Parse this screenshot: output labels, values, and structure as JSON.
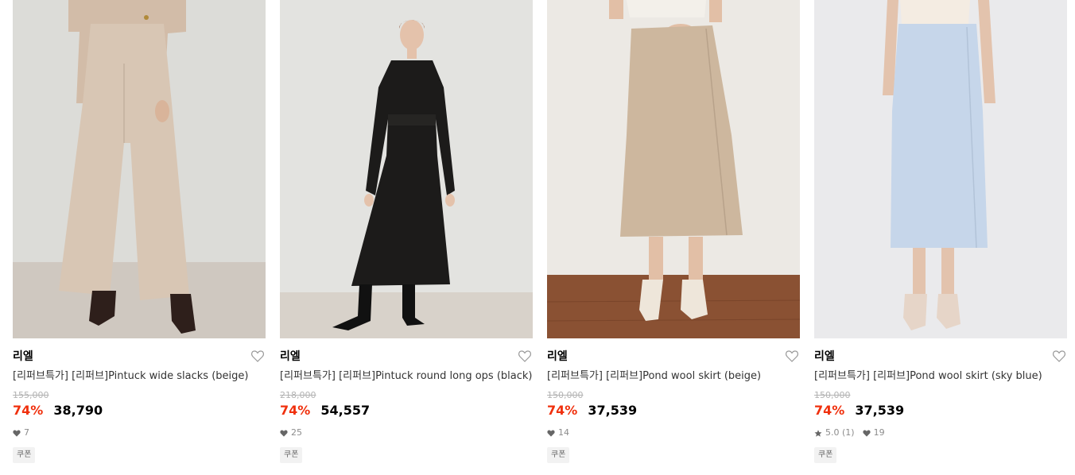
{
  "products": [
    {
      "brand": "리엘",
      "title": "[리퍼브특가] [리퍼브]Pintuck wide slacks (beige)",
      "original_price": "155,000",
      "discount": "74%",
      "price": "38,790",
      "rating": "",
      "likes": "7",
      "coupon": "쿠폰",
      "colors": {
        "bg": "#dcdcd8",
        "floor": "#cfc8c0",
        "garment": "#d8c6b4",
        "shoe": "#2e1f1b"
      }
    },
    {
      "brand": "리엘",
      "title": "[리퍼브특가] [리퍼브]Pintuck round long ops (black)",
      "original_price": "218,000",
      "discount": "74%",
      "price": "54,557",
      "rating": "",
      "likes": "25",
      "coupon": "쿠폰",
      "colors": {
        "bg": "#e3e3e0",
        "floor": "#d8d2ca",
        "garment": "#1c1b1a",
        "shoe": "#111111"
      }
    },
    {
      "brand": "리엘",
      "title": "[리퍼브특가] [리퍼브]Pond wool skirt (beige)",
      "original_price": "150,000",
      "discount": "74%",
      "price": "37,539",
      "rating": "",
      "likes": "14",
      "coupon": "쿠폰",
      "colors": {
        "bg": "#ece9e4",
        "floor": "#8a5133",
        "garment": "#cdb79e",
        "shoe": "#eee6da"
      }
    },
    {
      "brand": "리엘",
      "title": "[리퍼브특가] [리퍼브]Pond wool skirt (sky blue)",
      "original_price": "150,000",
      "discount": "74%",
      "price": "37,539",
      "rating": "5.0 (1)",
      "likes": "19",
      "coupon": "쿠폰",
      "colors": {
        "bg": "#eaeaec",
        "floor": "#e6e4e4",
        "garment": "#c6d6ea",
        "shoe": "#e6d5c8"
      }
    }
  ],
  "icons": {
    "wishlist": "heart-outline-icon",
    "likes": "heart-filled-icon",
    "rating": "star-icon"
  }
}
